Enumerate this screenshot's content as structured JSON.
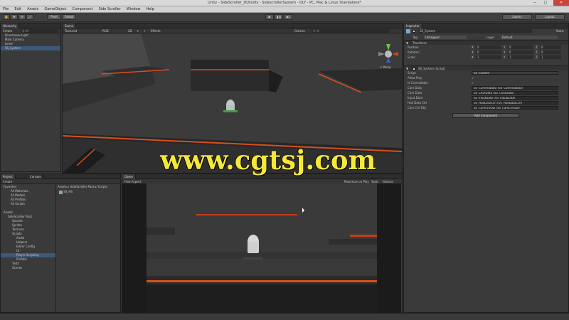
{
  "window": {
    "title": "Unity - SideScroller_DLYunity - SidescrollerSystem - DLY - PC, Mac & Linux Standalone*",
    "controls": [
      "−",
      "□",
      "✕"
    ]
  },
  "menu": [
    "File",
    "Edit",
    "Assets",
    "GameObject",
    "Component",
    "Side Scroller",
    "Window",
    "Help"
  ],
  "toolbar": {
    "tools": [
      "✋",
      "✥",
      "⟳",
      "⤢"
    ],
    "pivot": "Pivot",
    "global": "Global",
    "play": "▶",
    "pause": "❚❚",
    "step": "▶|",
    "layers": "Layers",
    "layout": "Layout"
  },
  "hierarchy": {
    "tab": "Hierarchy",
    "create": "Create",
    "search_placeholder": "Q·All",
    "items": [
      "Directional Light",
      "Main Camera",
      "Level",
      "SS_System"
    ]
  },
  "scene": {
    "tab": "Scene",
    "shading": "Textured",
    "mode": "RGB",
    "toggles": [
      "2D",
      "☀",
      "♪"
    ],
    "effects": "Effects",
    "gizmos": "Gizmos",
    "search": "Q·All",
    "persp": "< Persp"
  },
  "project": {
    "tabs": [
      "Project",
      "Console"
    ],
    "create": "Create",
    "breadcrumb": "Assets ▸ SideScroller Pack ▸ Scripts",
    "favorites": {
      "header": "Favorites",
      "items": [
        "All Materials",
        "All Models",
        "All Prefabs",
        "All Scripts"
      ]
    },
    "assets": {
      "header": "Assets",
      "items": [
        "SideScroller Pack",
        "Sounds",
        "Sprites",
        "Textures",
        "Scripts",
        "Audio",
        "Helpers",
        "Editor Config",
        "UI",
        "Player Scripting",
        "Prefabs",
        "Tests",
        "Scenes"
      ]
    },
    "file": "SS_HS"
  },
  "game": {
    "tab": "Game",
    "aspect": "Free Aspect",
    "options": [
      "Maximize on Play",
      "Stats",
      "Gizmos"
    ]
  },
  "inspector": {
    "tab": "Inspector",
    "object_name": "SS_System",
    "static": "Static",
    "tag_label": "Tag",
    "tag": "Untagged",
    "layer_label": "Layer",
    "layer": "Default",
    "transform": {
      "header": "Transform",
      "rows": [
        {
          "label": "Position",
          "x": "0",
          "y": "0",
          "z": "0"
        },
        {
          "label": "Rotation",
          "x": "0",
          "y": "0",
          "z": "0"
        },
        {
          "label": "Scale",
          "x": "1",
          "y": "1",
          "z": "1"
        }
      ]
    },
    "component": {
      "header": "SS_System (Script)",
      "rows": [
        {
          "label": "Script",
          "value": "SS_System"
        },
        {
          "label": "Allow Play",
          "value": "✓"
        },
        {
          "label": "Is Controllable",
          "value": "✓"
        },
        {
          "label": "Cam Data",
          "value": "SS_CameraData (SS_CameraData)"
        },
        {
          "label": "Char Data",
          "value": "SS_CharData (SS_CharData)"
        },
        {
          "label": "Input Data",
          "value": "SS_InputData (SS_InputData)"
        },
        {
          "label": "Hud Data Ctrl",
          "value": "SS_HudDataCtrl (SS_HudDataCtrl)"
        },
        {
          "label": "Cam Ctrl Obj",
          "value": "SS_CamCtrlObj (SS_CamCtrlObj)"
        }
      ]
    },
    "add_component": "Add Component"
  },
  "watermark": "www.cgtsj.com",
  "colors": {
    "accent_orange": "#d8501c",
    "selection": "#3d5878",
    "watermark": "#f5e83a"
  }
}
